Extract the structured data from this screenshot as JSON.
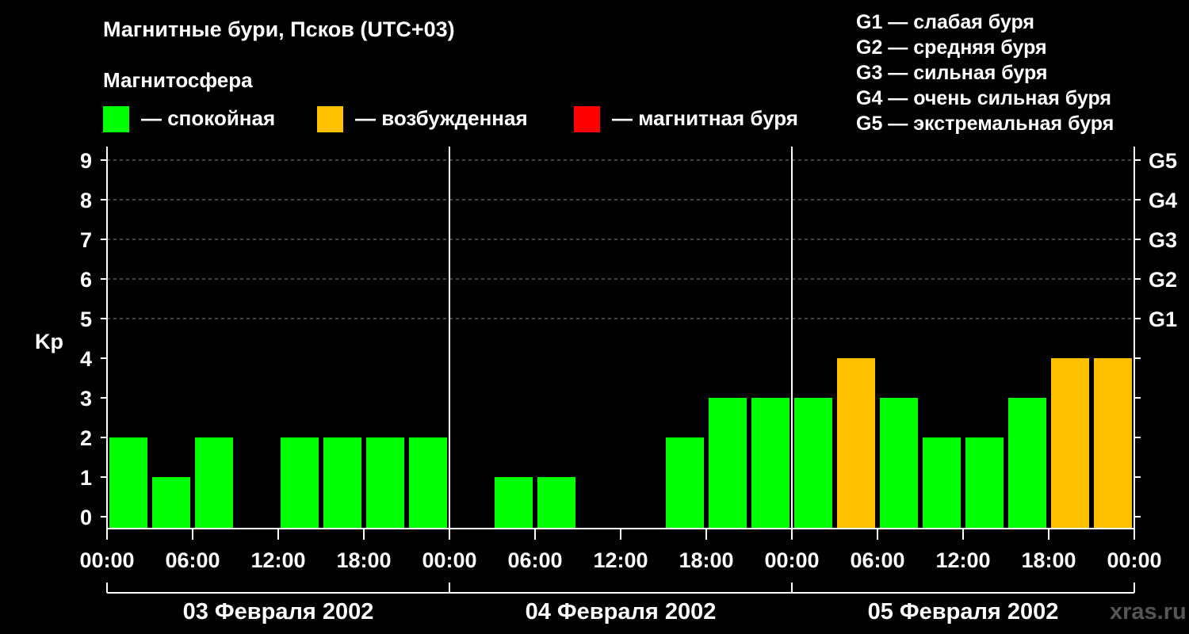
{
  "title": "Магнитные бури, Псков (UTC+03)",
  "magnetosphere_title": "Магнитосфера",
  "legend": [
    {
      "label": "— спокойная",
      "color": "#00ff00"
    },
    {
      "label": "— возбужденная",
      "color": "#ffc000"
    },
    {
      "label": "— магнитная буря",
      "color": "#ff0000"
    }
  ],
  "g_scale": [
    "G1 — слабая буря",
    "G2 — средняя буря",
    "G3 — сильная буря",
    "G4 — очень сильная буря",
    "G5 — экстремальная буря"
  ],
  "watermark": "xras.ru",
  "chart_data": {
    "type": "bar",
    "ylabel": "Kp",
    "ylim": [
      0,
      9
    ],
    "yticks": [
      0,
      1,
      2,
      3,
      4,
      5,
      6,
      7,
      8,
      9
    ],
    "right_ticks": [
      {
        "value": 5,
        "label": "G1"
      },
      {
        "value": 6,
        "label": "G2"
      },
      {
        "value": 7,
        "label": "G3"
      },
      {
        "value": 8,
        "label": "G4"
      },
      {
        "value": 9,
        "label": "G5"
      }
    ],
    "xtick_labels": [
      "00:00",
      "06:00",
      "12:00",
      "18:00",
      "00:00",
      "06:00",
      "12:00",
      "18:00",
      "00:00",
      "06:00",
      "12:00",
      "18:00",
      "00:00"
    ],
    "days": [
      "03 Февраля 2002",
      "04 Февраля 2002",
      "05 Февраля 2002"
    ],
    "interval_hours": 3,
    "values": [
      2,
      1,
      2,
      0,
      2,
      2,
      2,
      2,
      0,
      1,
      1,
      0,
      0,
      2,
      3,
      3,
      3,
      4,
      3,
      2,
      2,
      3,
      4,
      4
    ],
    "colors": {
      "quiet": "#00ff00",
      "active": "#ffc000",
      "storm": "#ff0000"
    },
    "grid": true
  }
}
